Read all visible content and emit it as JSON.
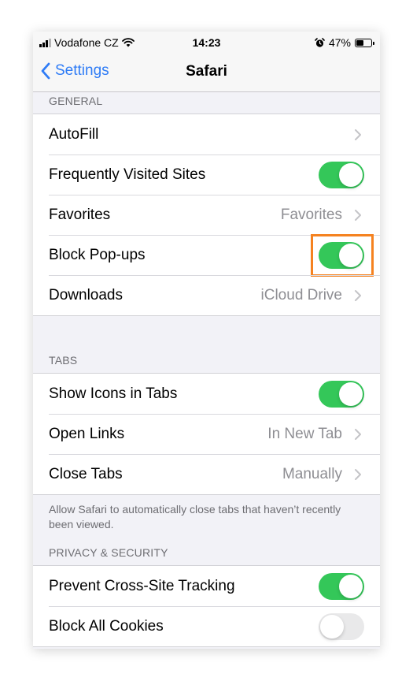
{
  "status_bar": {
    "carrier": "Vodafone CZ",
    "time": "14:23",
    "battery_percent": "47%",
    "icons": [
      "signal-icon",
      "wifi-icon",
      "alarm-icon",
      "battery-icon"
    ]
  },
  "nav": {
    "back_label": "Settings",
    "title": "Safari"
  },
  "sections": {
    "general": {
      "header": "GENERAL",
      "rows": {
        "autofill": {
          "label": "AutoFill"
        },
        "frequently_visited": {
          "label": "Frequently Visited Sites",
          "toggle_on": true
        },
        "favorites": {
          "label": "Favorites",
          "value": "Favorites"
        },
        "block_popups": {
          "label": "Block Pop-ups",
          "toggle_on": true,
          "highlighted": true
        },
        "downloads": {
          "label": "Downloads",
          "value": "iCloud Drive"
        }
      }
    },
    "tabs": {
      "header": "TABS",
      "rows": {
        "show_icons": {
          "label": "Show Icons in Tabs",
          "toggle_on": true
        },
        "open_links": {
          "label": "Open Links",
          "value": "In New Tab"
        },
        "close_tabs": {
          "label": "Close Tabs",
          "value": "Manually"
        }
      },
      "footer": "Allow Safari to automatically close tabs that haven’t recently been viewed."
    },
    "privacy": {
      "header": "PRIVACY & SECURITY",
      "rows": {
        "prevent_tracking": {
          "label": "Prevent Cross-Site Tracking",
          "toggle_on": true
        },
        "block_cookies": {
          "label": "Block All Cookies",
          "toggle_on": false
        }
      }
    }
  },
  "colors": {
    "accent_blue": "#2f7cf6",
    "toggle_green": "#34c759",
    "highlight_orange": "#f58220",
    "secondary_text": "#8e8e93"
  }
}
